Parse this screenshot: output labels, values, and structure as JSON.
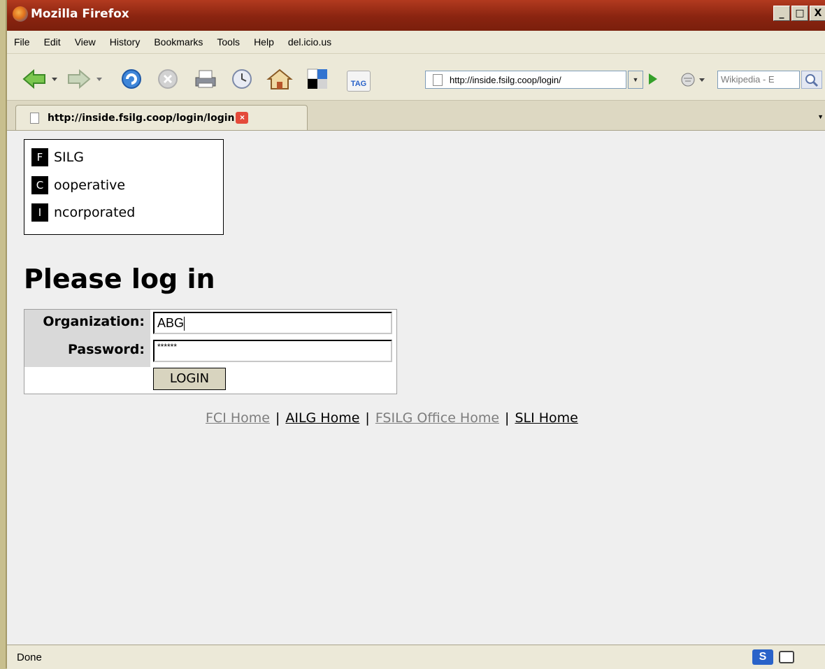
{
  "window": {
    "title": "Mozilla Firefox",
    "controls": {
      "minimize": "_",
      "maximize": "□",
      "close": "X"
    }
  },
  "menu": [
    "File",
    "Edit",
    "View",
    "History",
    "Bookmarks",
    "Tools",
    "Help",
    "del.icio.us"
  ],
  "toolbar": {
    "icons": [
      "back-icon",
      "forward-icon",
      "reload-icon",
      "stop-icon",
      "print-icon",
      "history-icon",
      "home-icon",
      "delicious-icon",
      "tag-icon"
    ],
    "tag_label": "TAG",
    "url": "http://inside.fsilg.coop/login/",
    "search_placeholder": "Wikipedia - E"
  },
  "tab": {
    "title": "http://inside.fsilg.coop/login/login"
  },
  "logo": [
    {
      "letter": "F",
      "word": "SILG"
    },
    {
      "letter": "C",
      "word": "ooperative"
    },
    {
      "letter": "I",
      "word": "ncorporated"
    }
  ],
  "page": {
    "heading": "Please log in",
    "org_label": "Organization:",
    "org_value": "ABG",
    "password_label": "Password:",
    "password_value": "******",
    "login_button": "LOGIN"
  },
  "footer": {
    "links": [
      {
        "label": "FCI Home",
        "visited": true
      },
      {
        "label": "AILG Home",
        "visited": false
      },
      {
        "label": "FSILG Office Home",
        "visited": true
      },
      {
        "label": "SLI Home",
        "visited": false
      }
    ],
    "separator": "|"
  },
  "status": {
    "text": "Done",
    "icon_label": "S"
  },
  "colors": {
    "titlebar": "#8a2410",
    "chrome": "#ece9d8",
    "content_bg": "#efefef",
    "visited_link": "#7d7d7d"
  }
}
